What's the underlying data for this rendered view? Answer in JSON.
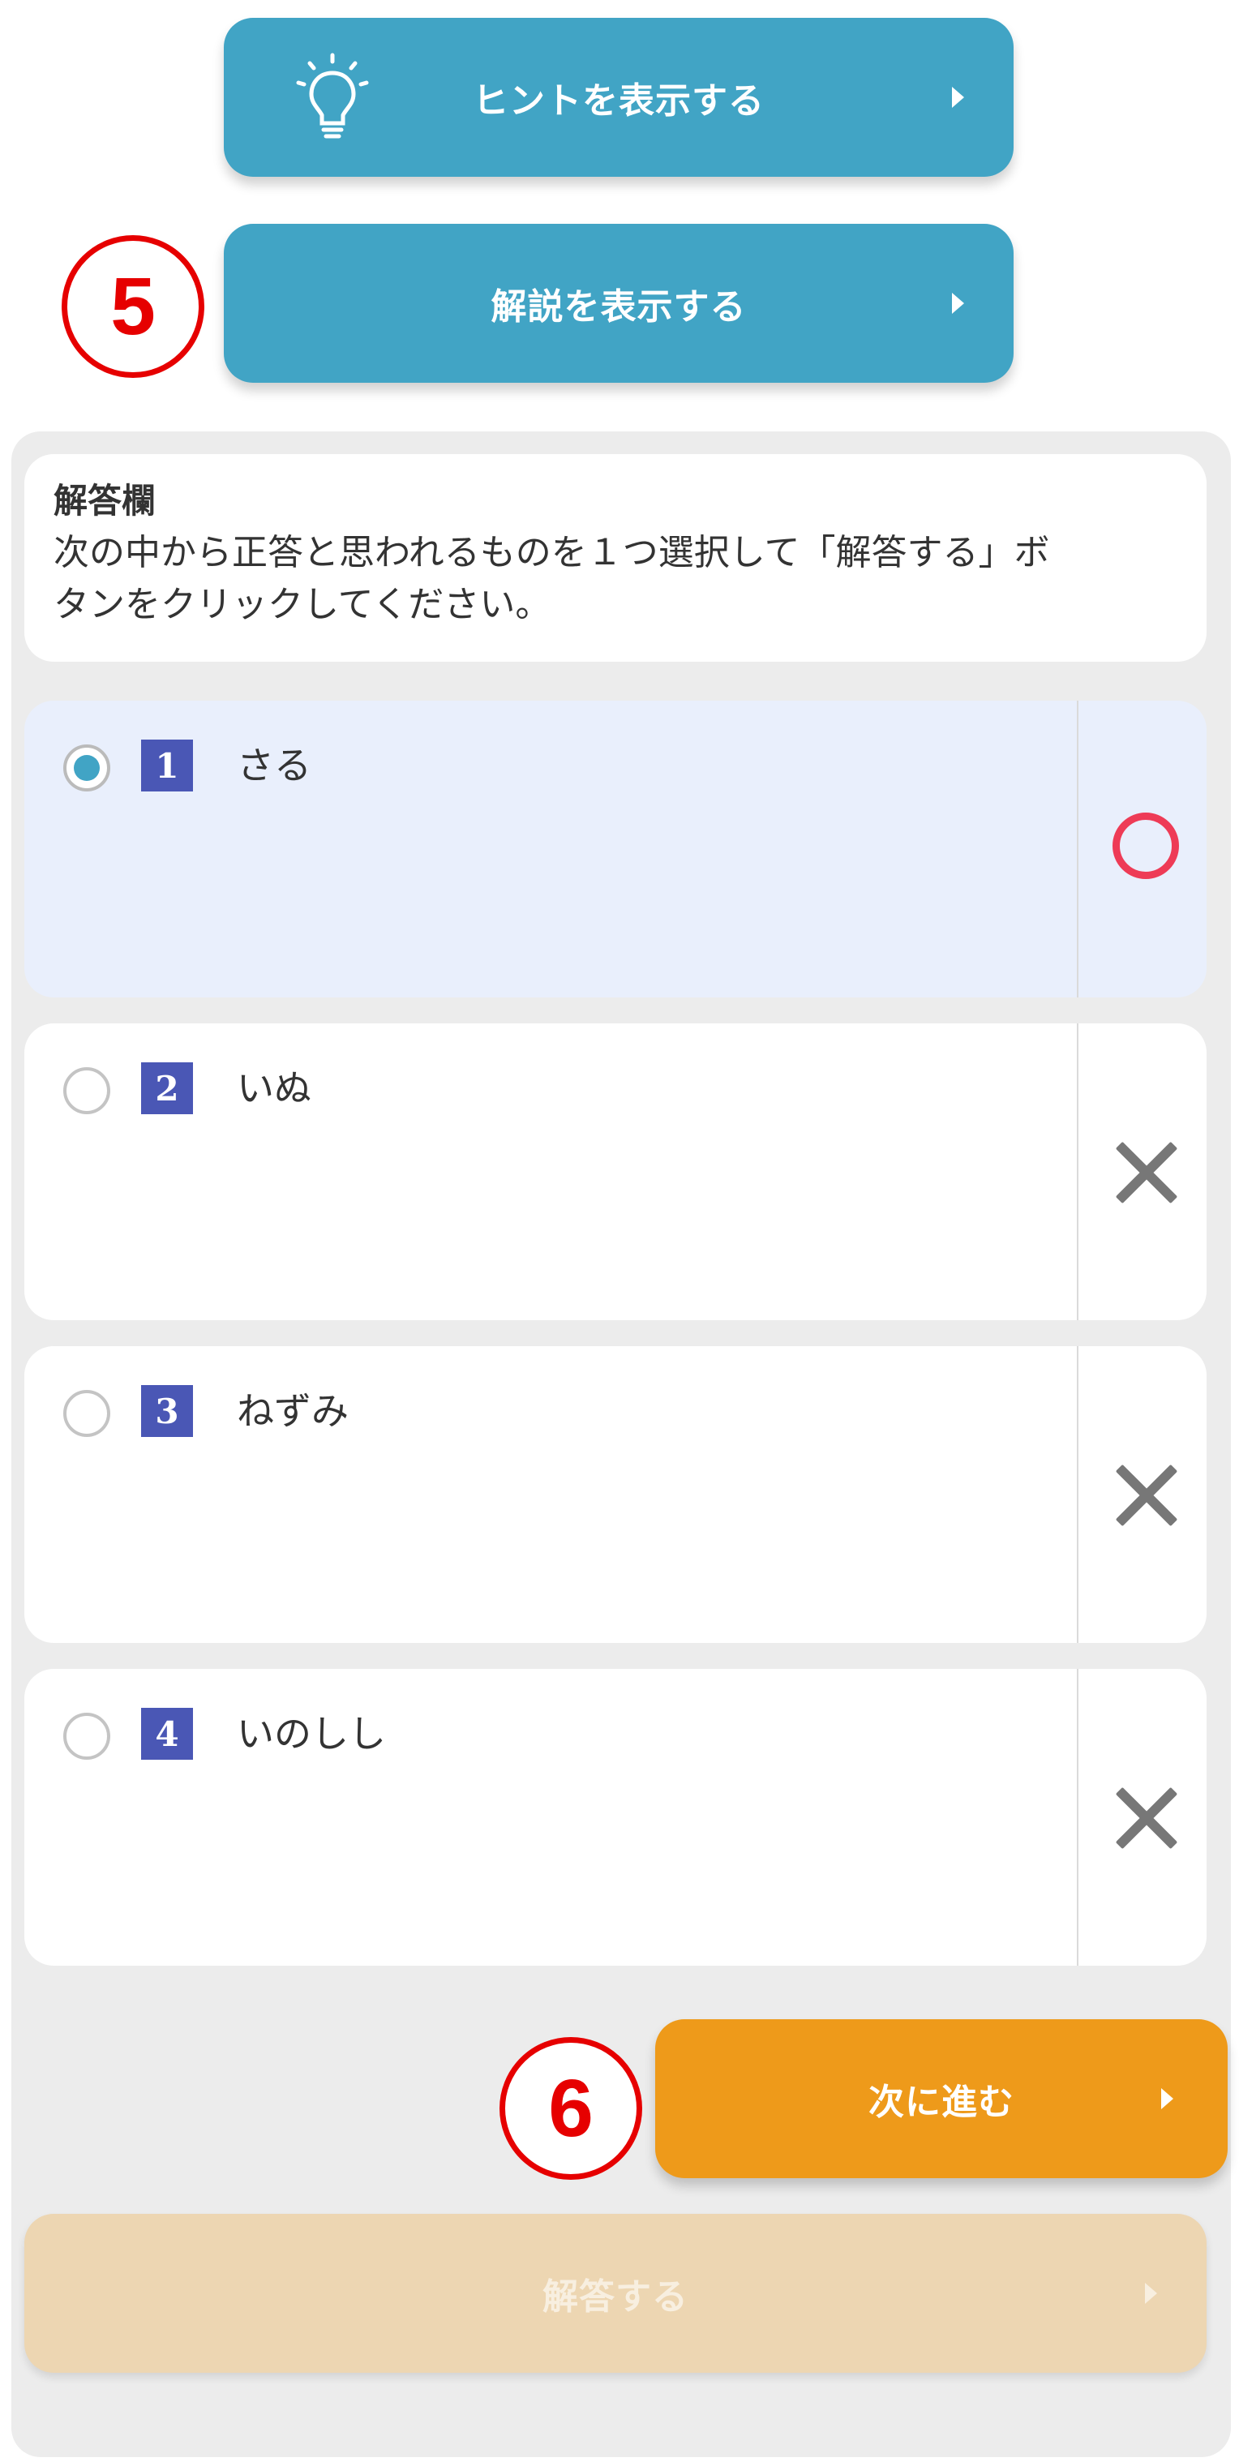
{
  "hint_button": {
    "label": "ヒントを表示する",
    "icon": "lightbulb-icon"
  },
  "explain_button": {
    "label": "解説を表示する"
  },
  "markers": {
    "step5": "5",
    "step6": "6"
  },
  "answer_panel": {
    "title": "解答欄",
    "instruction_line1": "次の中から正答と思われるものを１つ選択して「解答する」ボ",
    "instruction_line2": "タンをクリックしてください。"
  },
  "choices": [
    {
      "number": "1",
      "text": "さる",
      "selected": true,
      "result": "correct"
    },
    {
      "number": "2",
      "text": "いぬ",
      "selected": false,
      "result": "incorrect"
    },
    {
      "number": "3",
      "text": "ねずみ",
      "selected": false,
      "result": "incorrect"
    },
    {
      "number": "4",
      "text": "いのしし",
      "selected": false,
      "result": "incorrect"
    }
  ],
  "next_button": {
    "label": "次に進む"
  },
  "answer_button": {
    "label": "解答する",
    "disabled": true
  },
  "colors": {
    "primary_blue": "#41a4c5",
    "orange": "#ee9a1a",
    "orange_disabled": "#edd6b2",
    "number_badge": "#4a57b5",
    "marker_red": "#e60000",
    "correct_mark": "#ee3b56",
    "selected_bg": "#e9effc"
  }
}
